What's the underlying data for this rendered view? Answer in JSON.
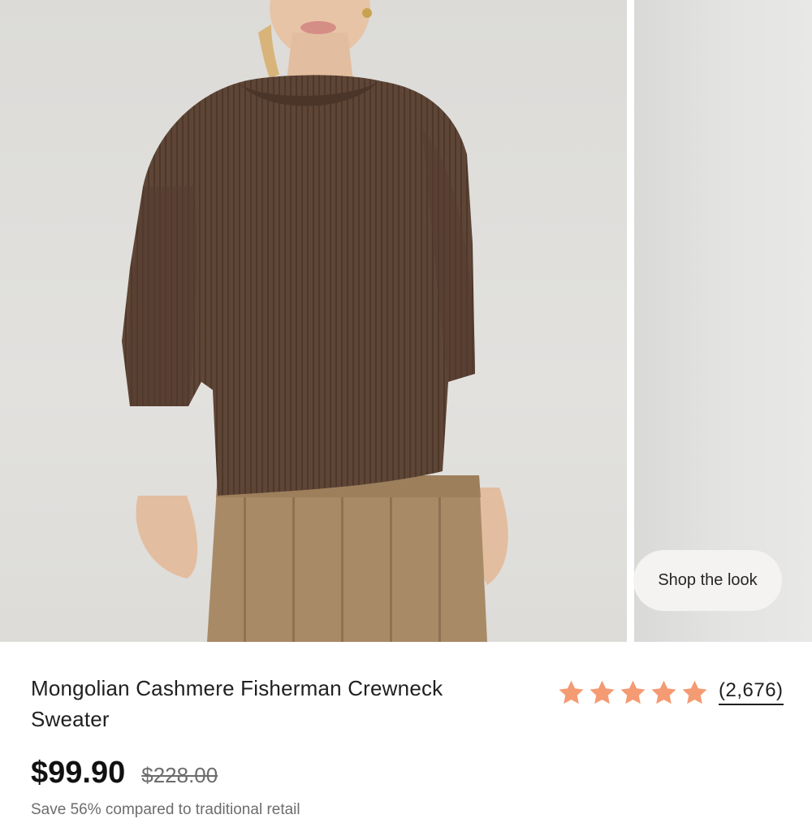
{
  "product": {
    "title": "Mongolian Cashmere Fisherman Crewneck Sweater",
    "rating": {
      "stars": 5,
      "count_label": "(2,676)",
      "star_color": "#f49b73"
    },
    "price": "$99.90",
    "original_price": "$228.00",
    "savings_text": "Save 56% compared to traditional retail"
  },
  "gallery": {
    "shop_look_label": "Shop the look"
  },
  "colors": {
    "sweater": "#5e4535",
    "trousers": "#a98a66",
    "backdrop": "#e0dfdc"
  }
}
